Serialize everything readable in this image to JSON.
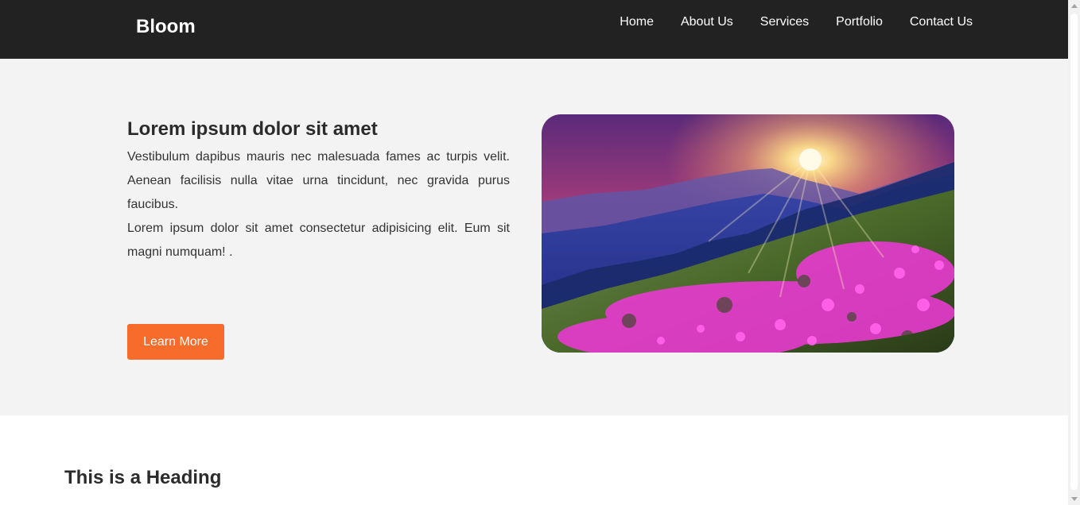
{
  "header": {
    "brand": "Bloom",
    "nav": [
      "Home",
      "About Us",
      "Services",
      "Portfolio",
      "Contact Us"
    ]
  },
  "hero": {
    "title": "Lorem ipsum dolor sit amet",
    "paragraph_1": "Vestibulum dapibus mauris nec malesuada fames ac turpis velit. Aenean facilisis nulla vitae urna tincidunt, nec gravida purus faucibus.",
    "paragraph_2": "Lorem ipsum dolor sit amet consectetur adipisicing elit. Eum sit magni numquam! .",
    "button_label": "Learn More",
    "image_alt": "mountain sunset with pink flowers"
  },
  "section2": {
    "heading": "This is a Heading"
  },
  "colors": {
    "header_bg": "#222222",
    "hero_bg": "#f3f3f3",
    "accent": "#f76c2b"
  }
}
